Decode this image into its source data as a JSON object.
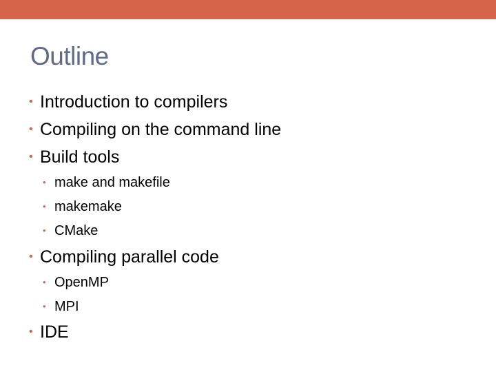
{
  "slide": {
    "title": "Outline",
    "bullets": [
      {
        "text": "Introduction to compilers"
      },
      {
        "text": "Compiling on the command line"
      },
      {
        "text": "Build tools"
      },
      {
        "text": "make and makefile"
      },
      {
        "text": "makemake"
      },
      {
        "text": "CMake"
      },
      {
        "text": "Compiling parallel code"
      },
      {
        "text": "OpenMP"
      },
      {
        "text": "MPI"
      },
      {
        "text": "IDE"
      }
    ]
  },
  "colors": {
    "accent": "#d5644a",
    "title": "#5e6b88",
    "text": "#000000",
    "background": "#ffffff"
  },
  "icons": {
    "bullet_marker": "bullet-icon"
  }
}
